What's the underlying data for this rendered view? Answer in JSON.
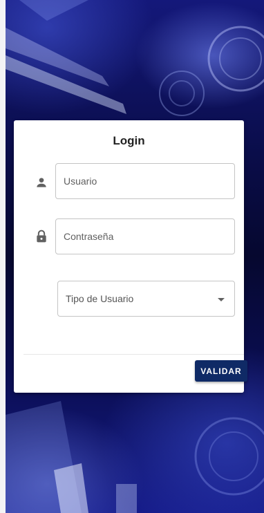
{
  "login": {
    "title": "Login",
    "username": {
      "placeholder": "Usuario",
      "value": ""
    },
    "password": {
      "placeholder": "Contraseña",
      "value": ""
    },
    "user_type": {
      "label": "Tipo de Usuario"
    },
    "submit_label": "VALIDAR"
  },
  "icons": {
    "username": "person-icon",
    "password": "lock-icon",
    "user_type": "caret-down-icon"
  },
  "colors": {
    "button": "#0f2a66",
    "icon": "#616161",
    "background": "#0a0d4a"
  }
}
